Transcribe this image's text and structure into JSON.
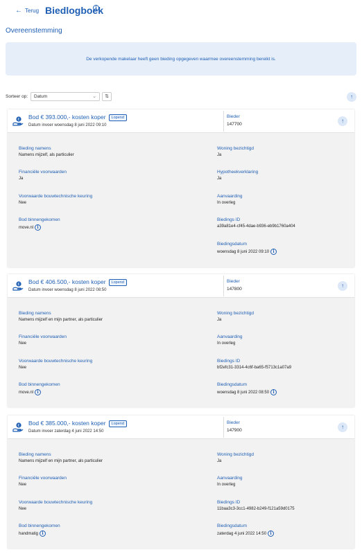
{
  "header": {
    "back_label": "Terug",
    "title": "Biedlogboek"
  },
  "subtitle": "Overeenstemming",
  "notice": "De verkopende makelaar heeft geen bieding opgegeven waarmee overeenstemming bereikt is.",
  "sort": {
    "label": "Sorteer op:",
    "value": "Datum"
  },
  "labels": {
    "bieder": "Bieder",
    "bieding_namens": "Bieding namens",
    "financiele_voorwaarden": "Financiële voorwaarden",
    "bouwtechnische_keuring": "Voorwaarde bouwtechnische keuring",
    "bod_binnengekomen": "Bod binnengekomen",
    "woning_bezichtigd": "Woning bezichtigd",
    "hypotheekverklaring": "Hypotheekverklaring",
    "aanvaarding": "Aanvaarding",
    "biedings_id": "Biedings ID",
    "biedingsdatum": "Biedingsdatum"
  },
  "bids": [
    {
      "title": "Bod € 393.000,- kosten koper",
      "status": "Lopend",
      "date": "Datum invoer woensdag 8 juni 2022 09:10",
      "bieder": "147700",
      "bieding_namens": "Namens mijzelf, als particulier",
      "financiele_voorwaarden": "Ja",
      "bouwtechnische_keuring": "Nee",
      "bod_binnengekomen": "move.nl",
      "woning_bezichtigd": "Ja",
      "hypotheekverklaring": "Ja",
      "aanvaarding": "In overleg",
      "biedings_id": "a39a81e4-cf45-4dae-b936-eb9b1760a404",
      "biedingsdatum": "woensdag 8 juni 2022 09:10"
    },
    {
      "title": "Bod € 406.500,- kosten koper",
      "status": "Lopend",
      "date": "Datum invoer woensdag 8 juni 2022 08:50",
      "bieder": "147800",
      "bieding_namens": "Namens mijzelf en mijn partner, als particulier",
      "financiele_voorwaarden": "Nee",
      "bouwtechnische_keuring": "Nee",
      "bod_binnengekomen": "move.nl",
      "woning_bezichtigd": "Ja",
      "aanvaarding": "In overleg",
      "biedings_id": "bf2efc31-3314-4c6f-ba65-f5713c1a07a9",
      "biedingsdatum": "woensdag 8 juni 2022 08:50"
    },
    {
      "title": "Bod € 385.000,- kosten koper",
      "status": "Lopend",
      "date": "Datum invoer zaterdag 4 juni 2022 14:50",
      "bieder": "147900",
      "bieding_namens": "Namens mijzelf en mijn partner, als particulier",
      "financiele_voorwaarden": "Nee",
      "bouwtechnische_keuring": "Nee",
      "bod_binnengekomen": "handmatig",
      "woning_bezichtigd": "Ja",
      "aanvaarding": "In overleg",
      "biedings_id": "11baa3c3-3cc1-4982-b249-f121a59d0175",
      "biedingsdatum": "zaterdag 4 juni 2022 14:50"
    }
  ]
}
